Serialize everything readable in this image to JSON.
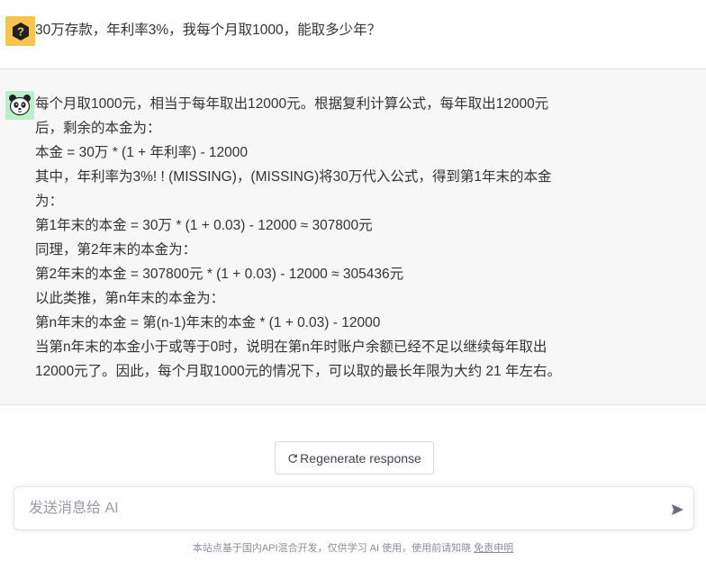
{
  "user_message": {
    "avatar_icon": "question-mark-icon",
    "avatar_color": "#f6c451",
    "text": "30万存款，年利率3%，我每个月取1000，能取多少年？"
  },
  "ai_message": {
    "avatar_icon": "panda-icon",
    "avatar_color": "#b9efca",
    "lines": [
      "每个月取1000元，相当于每年取出12000元。根据复利计算公式，每年取出12000元",
      "后，剩余的本金为：",
      "本金 = 30万 * (1 + 年利率) - 12000",
      "其中，年利率为3%! ! (MISSING)，(MISSING)将30万代入公式，得到第1年末的本金",
      "为：",
      "第1年末的本金 = 30万 * (1 + 0.03) - 12000 ≈ 307800元",
      "同理，第2年末的本金为：",
      "第2年末的本金 = 307800元 * (1 + 0.03) - 12000 ≈ 305436元",
      "以此类推，第n年末的本金为：",
      "第n年末的本金 = 第(n-1)年末的本金 * (1 + 0.03) - 12000",
      "当第n年末的本金小于或等于0时，说明在第n年时账户余额已经不足以继续每年取出",
      "12000元了。因此，每个月取1000元的情况下，可以取的最长年限为大约 21 年左右。"
    ]
  },
  "regenerate": {
    "label": "Regenerate response",
    "icon": "refresh-icon"
  },
  "composer": {
    "placeholder": "发送消息给 AI",
    "value": "",
    "send_icon": "send-icon"
  },
  "footer": {
    "text": "本站点基于国内API混合开发，仅供学习 AI 使用，使用前请知晓 ",
    "link": "免责申明"
  }
}
